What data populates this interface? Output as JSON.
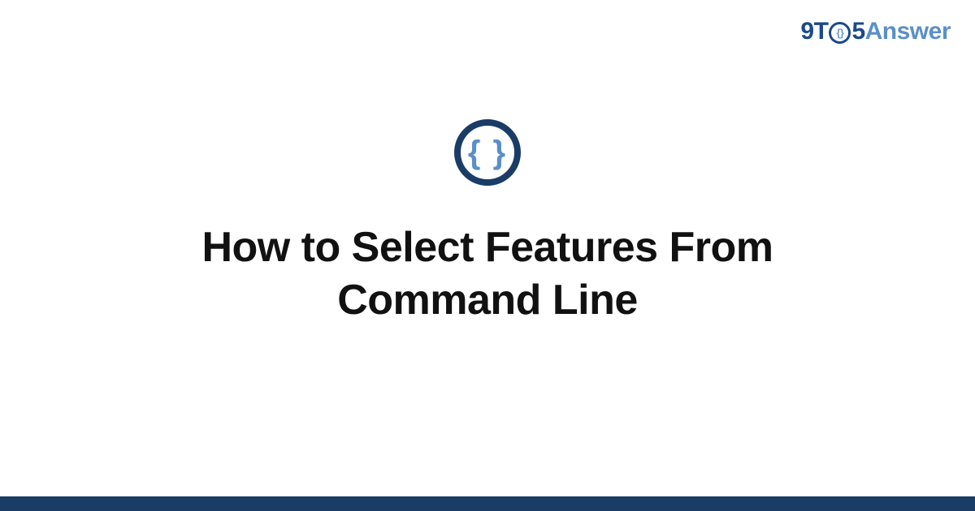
{
  "logo": {
    "part1": "9T",
    "o_inner": "{}",
    "part2": "5",
    "part3": "Answer"
  },
  "icon": {
    "name": "braces-icon",
    "glyph": "{ }"
  },
  "title": "How to Select Features From Command Line",
  "colors": {
    "brand_dark": "#1a3d66",
    "brand_mid": "#1a4a8a",
    "brand_light": "#5a8fc7"
  }
}
